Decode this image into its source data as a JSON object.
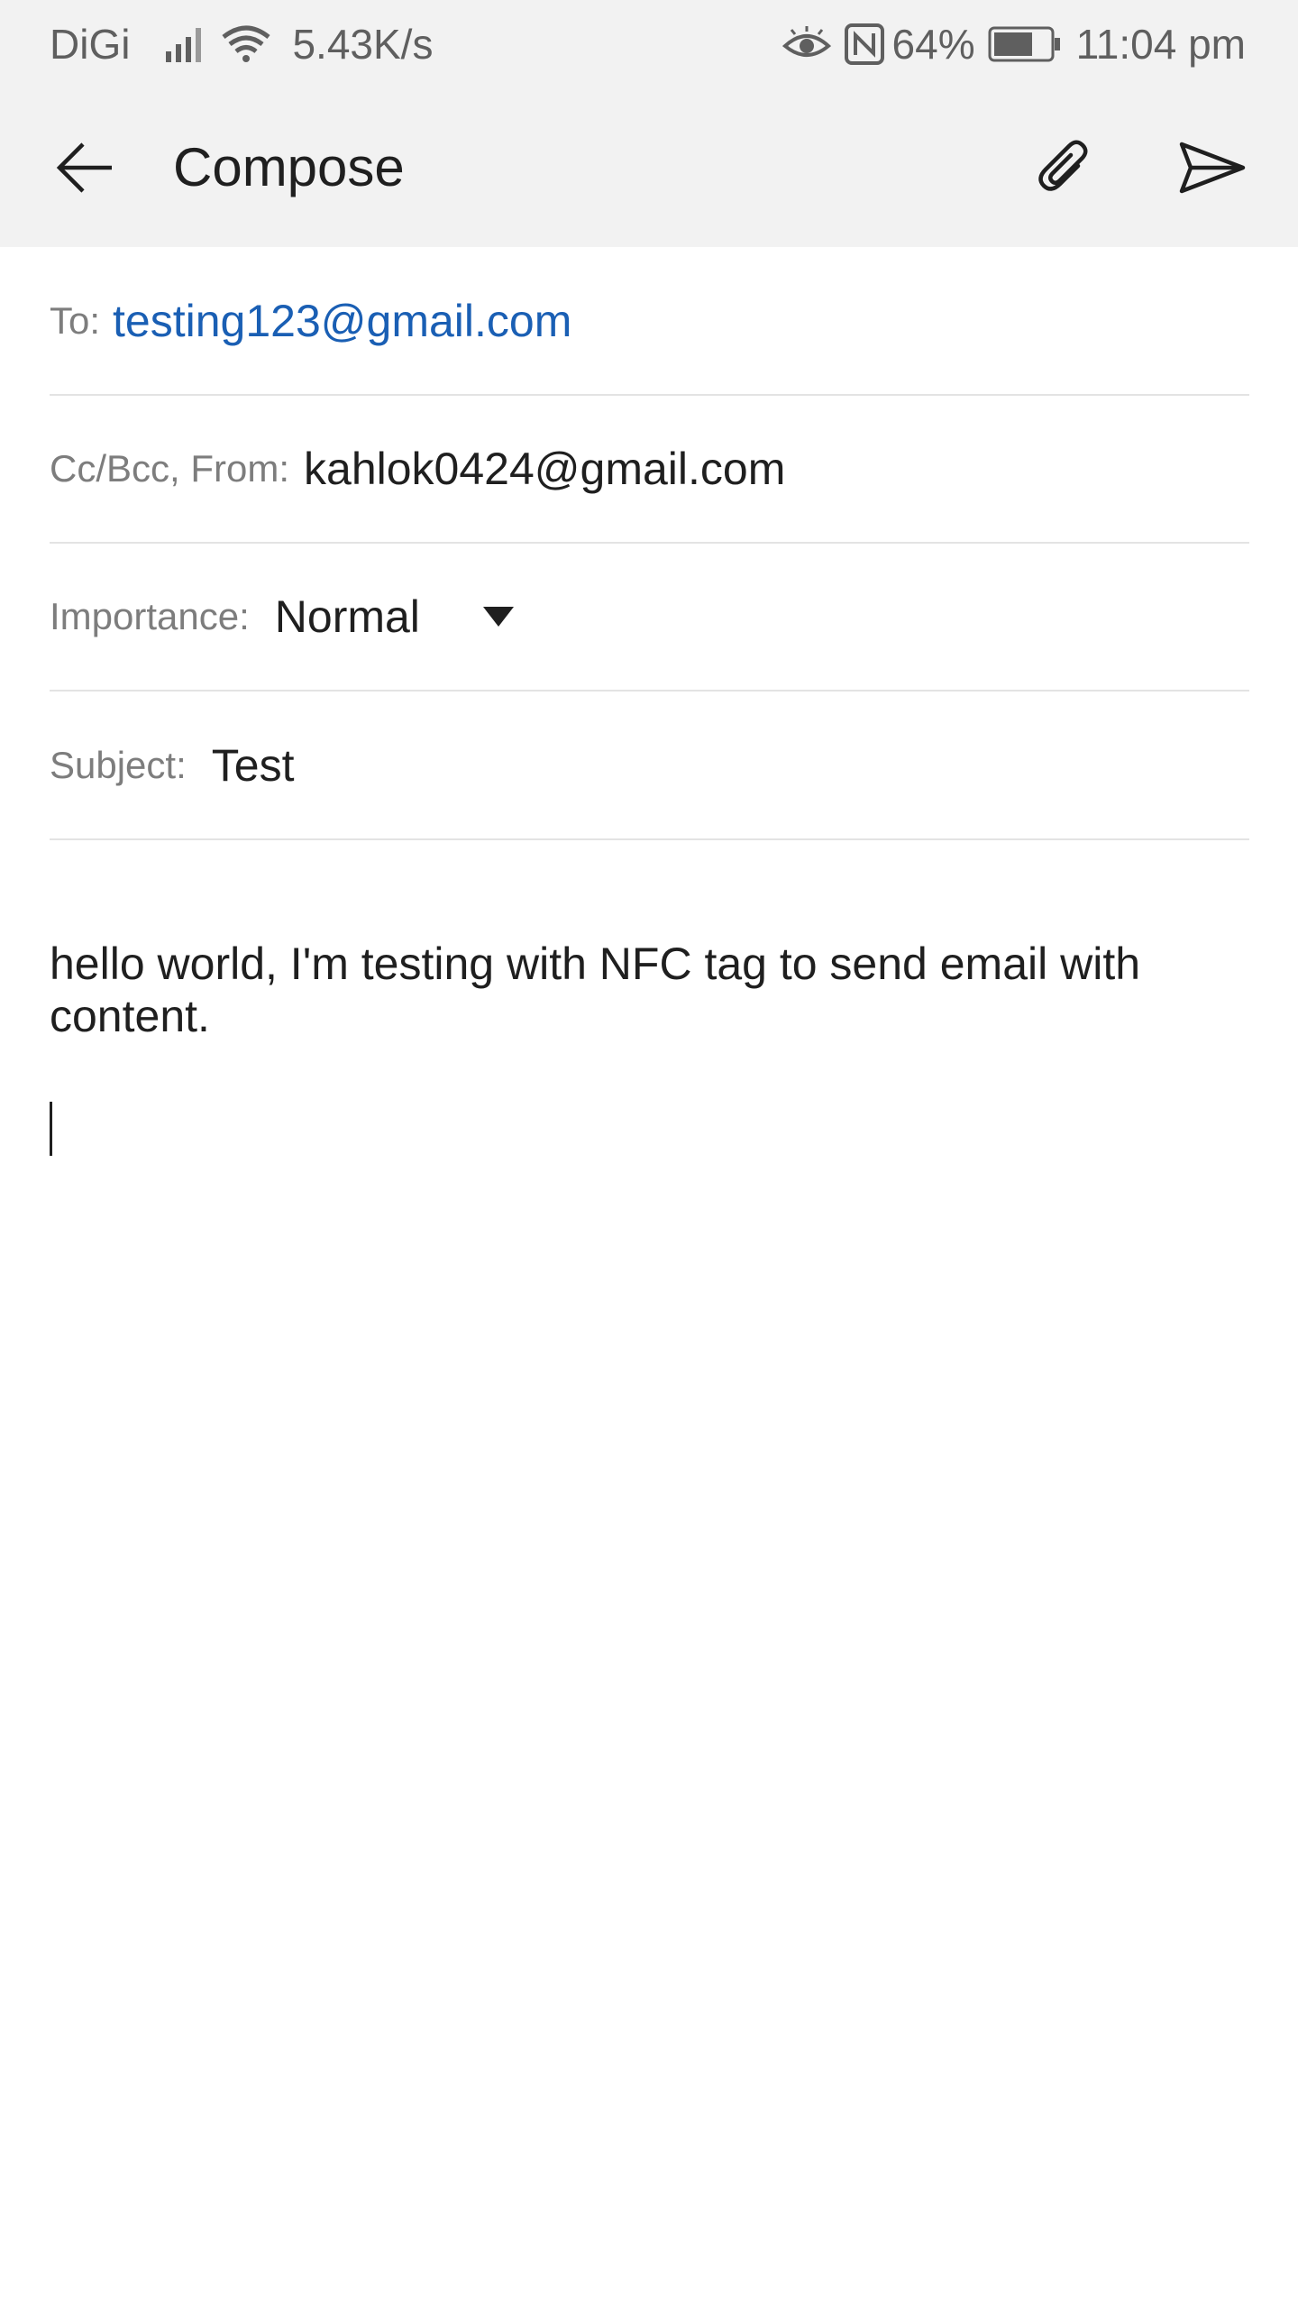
{
  "status_bar": {
    "carrier": "DiGi",
    "net_speed": "5.43K/s",
    "battery": "64%",
    "time": "11:04 pm",
    "icons": [
      "signal-icon",
      "wifi-icon",
      "eye-icon",
      "nfc-icon",
      "battery-icon"
    ]
  },
  "app_bar": {
    "title": "Compose",
    "icons": [
      "back-arrow-icon",
      "paperclip-icon",
      "send-icon"
    ]
  },
  "form": {
    "to_label": "To:",
    "to_value": "testing123@gmail.com",
    "cc_label": "Cc/Bcc, From:",
    "from_value": "kahlok0424@gmail.com",
    "importance_label": "Importance:",
    "importance_value": "Normal",
    "subject_label": "Subject:",
    "subject_value": "Test"
  },
  "body": {
    "text": "hello world, I'm testing with NFC tag to send email with content."
  },
  "colors": {
    "accent_link": "#1a5fb4",
    "bar_background": "#f2f2f2"
  }
}
